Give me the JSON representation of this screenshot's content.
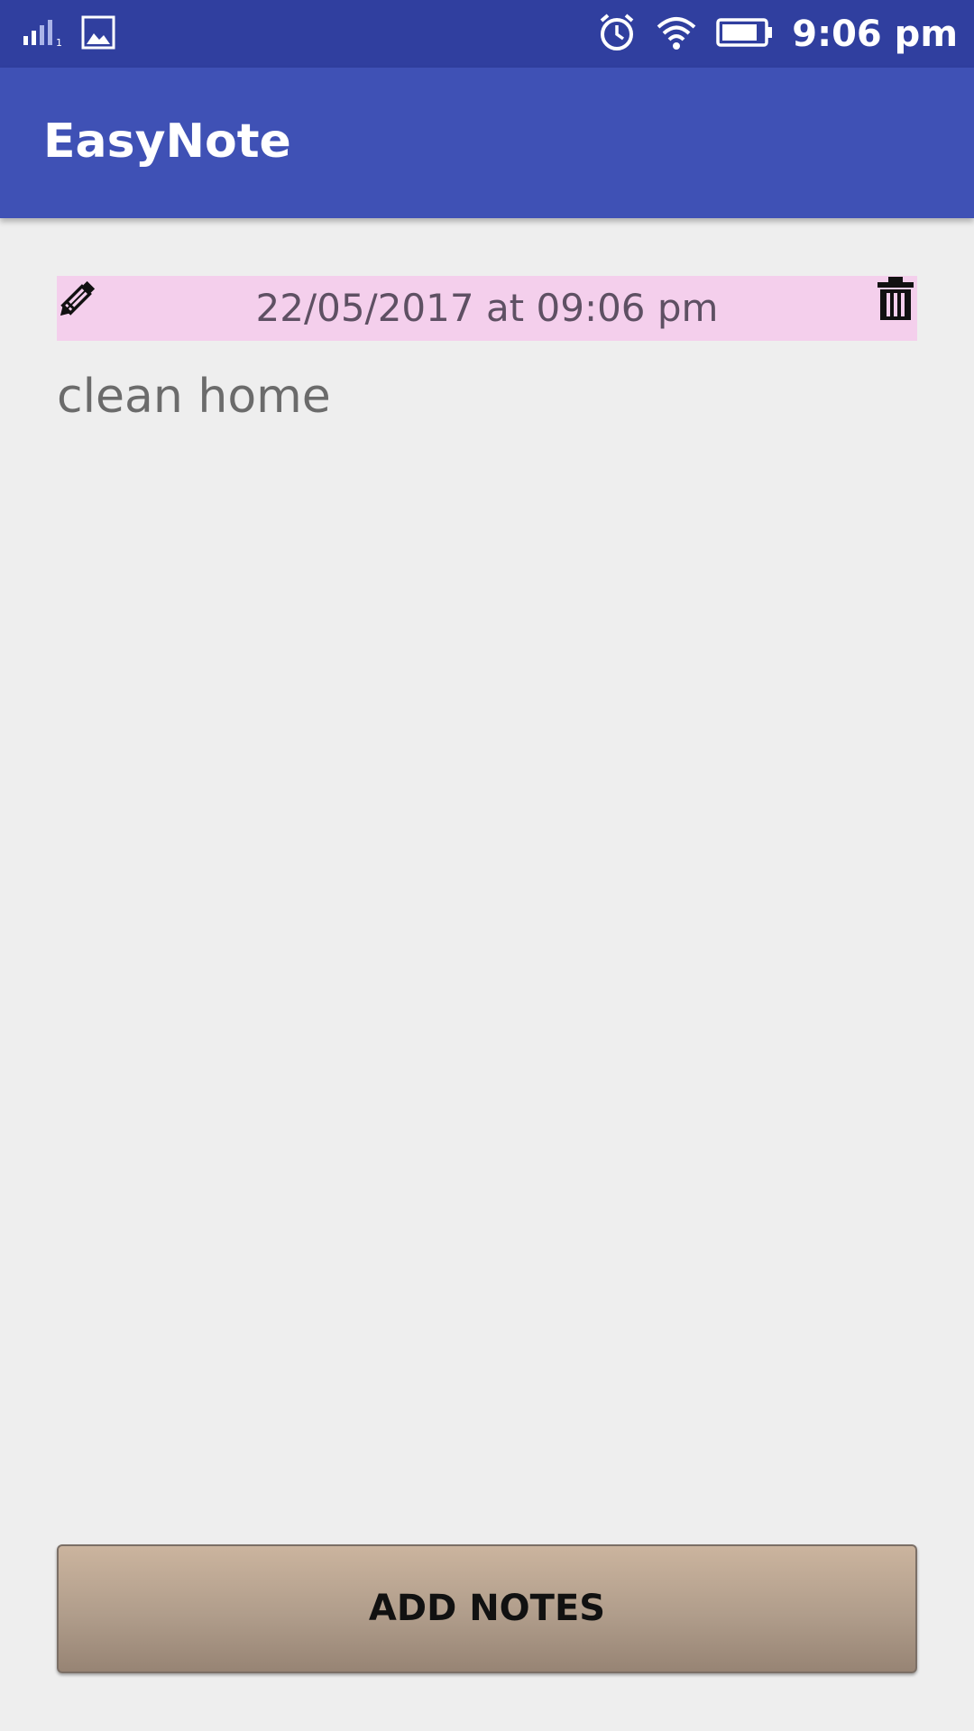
{
  "status_bar": {
    "time": "9:06 pm",
    "sim_label": "1",
    "icons": [
      "signal-icon",
      "gallery-icon",
      "alarm-icon",
      "wifi-icon",
      "battery-icon"
    ]
  },
  "app_bar": {
    "title": "EasyNote"
  },
  "notes": [
    {
      "date": "22/05/2017 at 09:06 pm",
      "text": "clean home",
      "edit_icon": "pencil-icon",
      "delete_icon": "trash-icon"
    }
  ],
  "add_button": {
    "label": "ADD NOTES"
  },
  "colors": {
    "status_bar": "#303f9f",
    "app_bar": "#3f51b5",
    "note_header": "#f4cfec",
    "background": "#eeeeee"
  }
}
